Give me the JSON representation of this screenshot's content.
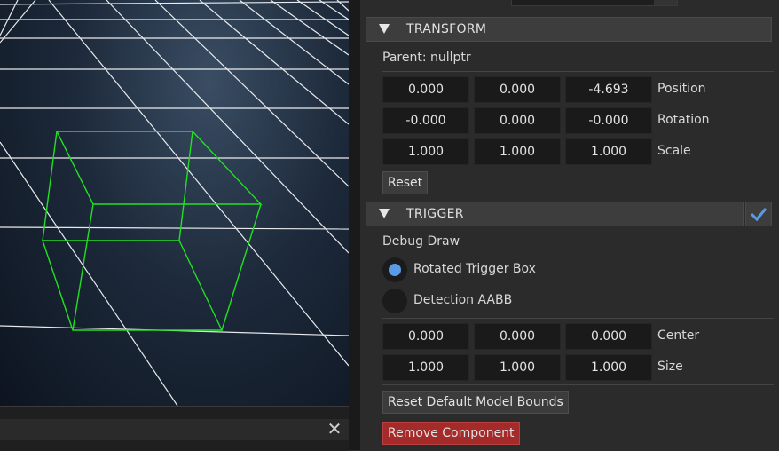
{
  "viewport": {
    "close_glyph": "✕"
  },
  "transform": {
    "title": "TRANSFORM",
    "parent_label": "Parent: nullptr",
    "position": {
      "x": "0.000",
      "y": "0.000",
      "z": "-4.693",
      "label": "Position"
    },
    "rotation": {
      "x": "-0.000",
      "y": "0.000",
      "z": "-0.000",
      "label": "Rotation"
    },
    "scale": {
      "x": "1.000",
      "y": "1.000",
      "z": "1.000",
      "label": "Scale"
    },
    "reset_label": "Reset"
  },
  "trigger": {
    "title": "TRIGGER",
    "enabled": true,
    "debug_draw_label": "Debug Draw",
    "options": [
      {
        "label": "Rotated Trigger Box",
        "selected": true
      },
      {
        "label": "Detection AABB",
        "selected": false
      }
    ],
    "center": {
      "x": "0.000",
      "y": "0.000",
      "z": "0.000",
      "label": "Center"
    },
    "size": {
      "x": "1.000",
      "y": "1.000",
      "z": "1.000",
      "label": "Size"
    },
    "reset_bounds_label": "Reset Default Model Bounds",
    "remove_label": "Remove Component"
  },
  "colors": {
    "accent": "#5b9ae6",
    "danger": "#a52a2a",
    "wireframe": "#22e022",
    "grid": "#ffffff"
  }
}
